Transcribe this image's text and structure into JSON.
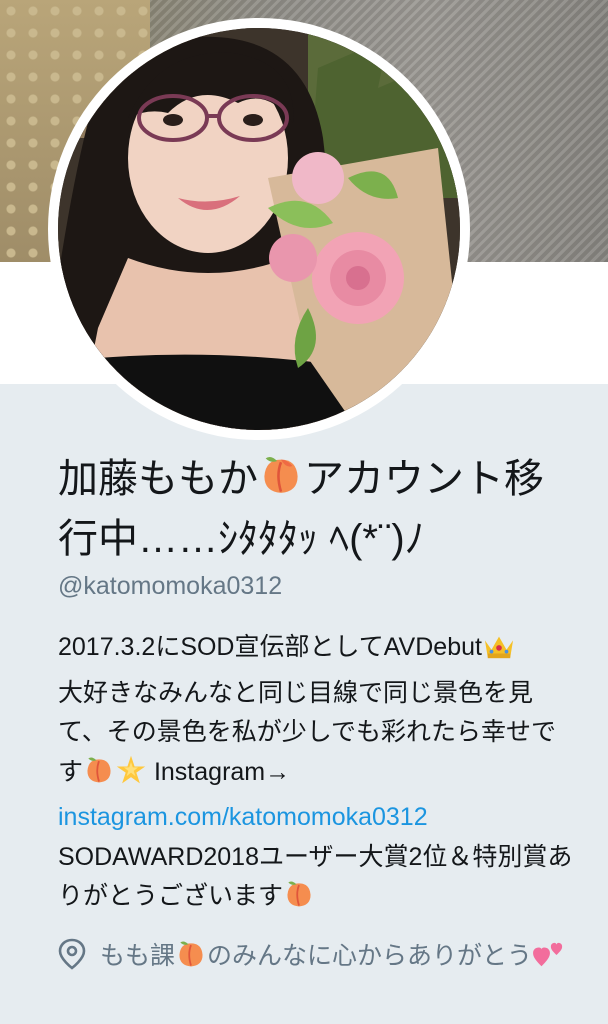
{
  "profile": {
    "display_name_part1": "加藤ももか",
    "display_name_part2": "アカウント移行中……ｼﾀﾀﾀｯ ﾍ(*¨)ﾉ",
    "screen_name": "@katomomoka0312",
    "bio": {
      "line1": "2017.3.2にSOD宣伝部としてAVDebut",
      "line2": "大好きなみんなと同じ目線で同じ景色を見て、その景色を私が少しでも彩れたら幸せです",
      "line3": " Instagram→",
      "link": "instagram.com/katomomoka0312",
      "line4": "SODAWARD2018ユーザー大賞2位＆特別賞ありがとうございます"
    },
    "location_part1": "もも課",
    "location_part2": "のみんなに心からありがとう"
  },
  "icons": {
    "peach": "peach-icon",
    "crown": "crown-icon",
    "star": "glowing-star-icon",
    "hearts": "two-hearts-icon",
    "pin": "location-pin-icon"
  },
  "colors": {
    "background": "#e6ecf0",
    "text": "#14171a",
    "secondary": "#657786",
    "link": "#1b95e0"
  }
}
